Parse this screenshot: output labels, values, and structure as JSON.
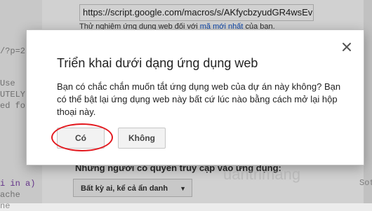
{
  "background": {
    "editor_lines": [
      "/?p=2",
      "Use",
      "UTELY",
      "ed fo",
      "i in a)",
      "ache",
      "ne"
    ],
    "url": "https://script.google.com/macros/s/AKfycbzyudGR4wsEv",
    "test_text": "Thử nghiệm ứng dụng web đối với ",
    "test_link": "mã mới nhất",
    "test_suffix": " của bạn.",
    "access_label": "Những người có quyền truy cập vào ứng dụng:",
    "access_value": "Bất kỳ ai, kể cả ẩn danh",
    "side_text": "Sote"
  },
  "dialog": {
    "title": "Triển khai dưới dạng ứng dụng web",
    "message": "Bạn có chắc chắn muốn tắt ứng dụng web của dự án này không? Bạn có thể bật lại ứng dụng web này bất cứ lúc nào bằng cách mở lại hộp thoại này.",
    "yes_label": "Có",
    "no_label": "Không",
    "close_icon": "close-icon"
  },
  "watermark": "uantrimang",
  "colors": {
    "highlight": "#e3191f",
    "link": "#1155cc"
  }
}
